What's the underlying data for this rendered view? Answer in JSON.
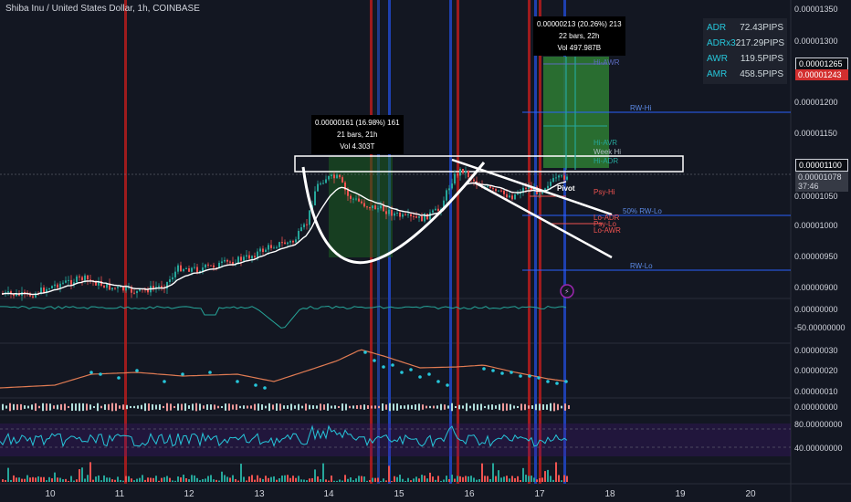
{
  "header": {
    "title": "Shiba Inu / United States Dollar, 1h, COINBASE"
  },
  "callouts": {
    "left": {
      "line1": "0.00000161 (16.98%) 161",
      "line2": "21 bars, 21h",
      "line3": "Vol 4.303T"
    },
    "right": {
      "line1": "0.00000213 (20.26%) 213",
      "line2": "22 bars, 22h",
      "line3": "Vol 497.987B"
    }
  },
  "stats": [
    {
      "label": "ADR",
      "value": "72.43PIPS"
    },
    {
      "label": "ADRx3",
      "value": "217.29PIPS"
    },
    {
      "label": "AWR",
      "value": "119.5PIPS"
    },
    {
      "label": "AMR",
      "value": "458.5PIPS"
    }
  ],
  "price_axis": {
    "labels": [
      "0.00001350",
      "0.00001300",
      "0.00001200",
      "0.00001150",
      "0.00001050",
      "0.00001000",
      "0.00000950",
      "0.00000900"
    ],
    "tag_265": "0.00001265",
    "tag_243": "0.00001243",
    "tag_100": "0.00001100",
    "current_price": "0.00001078",
    "countdown": "37:46"
  },
  "ind1_axis": [
    "0.00000000",
    "-50.00000000"
  ],
  "ind2_axis": [
    "0.00000030",
    "0.00000020",
    "0.00000010"
  ],
  "ind3_axis": [
    "0.00000000"
  ],
  "ind4_axis": [
    "80.00000000",
    "40.00000000"
  ],
  "level_labels": {
    "hi_awr": "Hi-AWR",
    "rw_hi": "RW-Hi",
    "hi_avr": "Hi-AVR",
    "week_hi": "Week Hi",
    "hi_adr": "Hi-ADR",
    "psy_hi": "Psy-Hi",
    "rw_lo_50": "50% RW-Lo",
    "lo_adr": "Lo-ADR",
    "psy_lo": "Psy-Lo",
    "lo_awr": "Lo-AWR",
    "rw_lo": "RW-Lo",
    "pivot": "Pivot"
  },
  "x_axis": [
    "10",
    "11",
    "12",
    "13",
    "14",
    "15",
    "16",
    "17",
    "18",
    "19",
    "20"
  ],
  "colors": {
    "bg": "#131722",
    "up": "#26a69a",
    "down": "#ef5350",
    "blue": "#2962ff",
    "red": "#ff1744"
  }
}
